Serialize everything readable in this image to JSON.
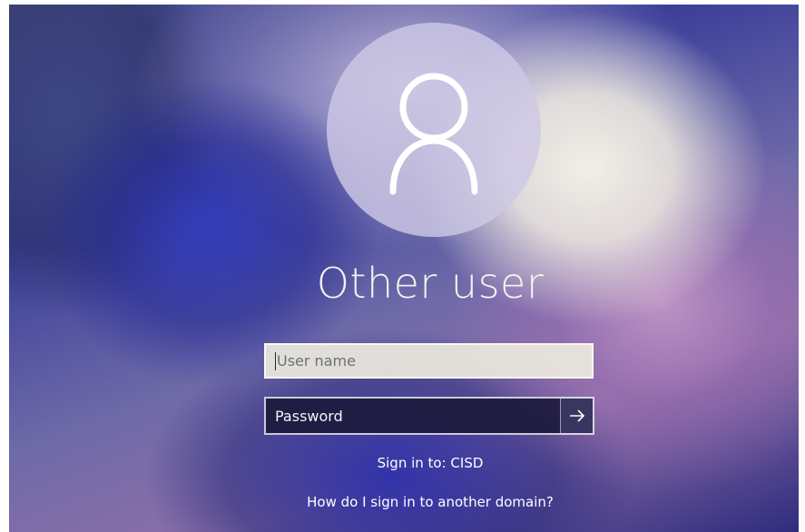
{
  "user": {
    "display_name": "Other user",
    "avatar_icon": "person-outline-icon"
  },
  "fields": {
    "username_placeholder": "User name",
    "password_placeholder": "Password"
  },
  "submit": {
    "icon": "arrow-right-icon"
  },
  "signin_target": "Sign in to: CISD",
  "domain_help_link": "How do I sign in to another domain?"
}
